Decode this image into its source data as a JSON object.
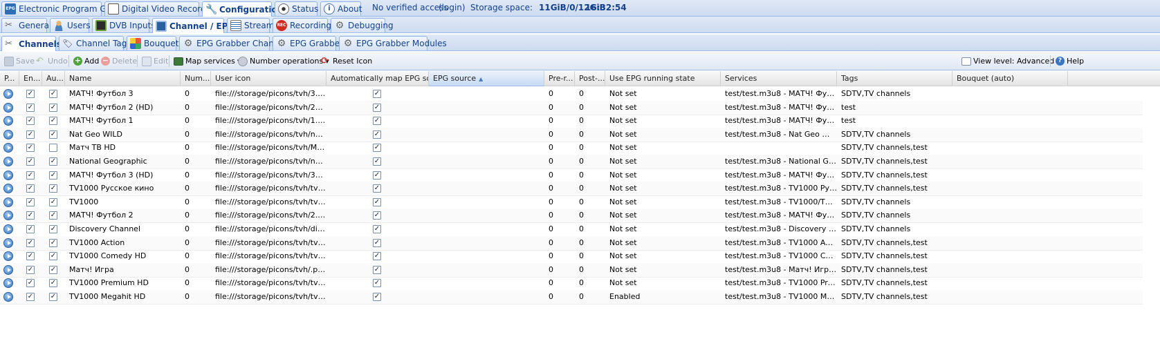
{
  "top_tabs": [
    {
      "label": "Electronic Program Guide",
      "icon": "epg-icon"
    },
    {
      "label": "Digital Video Recorder",
      "icon": "dvr-icon"
    },
    {
      "label": "Configuration",
      "icon": "wrench-icon",
      "active": true
    },
    {
      "label": "Status",
      "icon": "eye-icon"
    },
    {
      "label": "About",
      "icon": "info-icon"
    }
  ],
  "status": {
    "access": "No verified access",
    "login": "(login)",
    "storage_label": "Storage space:",
    "storage_value": "11GiB/0/12GiB",
    "time": "16:32:54"
  },
  "config_tabs": [
    {
      "label": "General"
    },
    {
      "label": "Users"
    },
    {
      "label": "DVB Inputs"
    },
    {
      "label": "Channel / EPG",
      "active": true
    },
    {
      "label": "Stream"
    },
    {
      "label": "Recording"
    },
    {
      "label": "Debugging"
    }
  ],
  "sub_tabs": [
    {
      "label": "Channels",
      "active": true
    },
    {
      "label": "Channel Tags"
    },
    {
      "label": "Bouquets"
    },
    {
      "label": "EPG Grabber Channels"
    },
    {
      "label": "EPG Grabber"
    },
    {
      "label": "EPG Grabber Modules"
    }
  ],
  "toolbar": {
    "save": "Save",
    "undo": "Undo",
    "add": "Add",
    "delete": "Delete",
    "edit": "Edit",
    "map_services": "Map services",
    "number_operations": "Number operations",
    "reset_icon": "Reset Icon",
    "view_level": "View level: Advanced",
    "help": "Help"
  },
  "columns": [
    "P...",
    "En...",
    "Au...",
    "Name",
    "Num...",
    "User icon",
    "Automatically map EPG sou...",
    "EPG source",
    "Pre-r...",
    "Post-...",
    "Use EPG running state",
    "Services",
    "Tags",
    "Bouquet (auto)"
  ],
  "rows": [
    {
      "enabled": true,
      "auto": true,
      "name": "МАТЧ! Футбол 3",
      "number": "0",
      "icon": "file:///storage/picons/tvh/3.png",
      "automap": true,
      "pre": "0",
      "post": "0",
      "running": "Not set",
      "services": "test/test.m3u8 - МАТЧ! Футбол 3...",
      "tags": "SDTV,TV channels"
    },
    {
      "enabled": true,
      "auto": true,
      "name": "МАТЧ! Футбол 2 (HD)",
      "number": "0",
      "icon": "file:///storage/picons/tvh/2hd.png",
      "automap": true,
      "pre": "0",
      "post": "0",
      "running": "Not set",
      "services": "test/test.m3u8 - МАТЧ! Футбол 2...",
      "tags": "test"
    },
    {
      "enabled": true,
      "auto": true,
      "name": "МАТЧ! Футбол 1",
      "number": "0",
      "icon": "file:///storage/picons/tvh/1.png",
      "automap": true,
      "pre": "0",
      "post": "0",
      "running": "Not set",
      "services": "test/test.m3u8 - МАТЧ! Футбол 1...",
      "tags": "test"
    },
    {
      "enabled": true,
      "auto": true,
      "name": "Nat Geo WILD",
      "number": "0",
      "icon": "file:///storage/picons/tvh/natgeow...",
      "automap": true,
      "pre": "0",
      "post": "0",
      "running": "Not set",
      "services": "test/test.m3u8 - Nat Geo WILD/N...",
      "tags": "SDTV,TV channels"
    },
    {
      "enabled": true,
      "auto": false,
      "name": "Матч ТВ HD",
      "number": "0",
      "icon": "file:///storage/picons/tvh/Матч ТВ...",
      "automap": true,
      "pre": "0",
      "post": "0",
      "running": "Not set",
      "services": "",
      "tags": "SDTV,TV channels,test"
    },
    {
      "enabled": true,
      "auto": true,
      "name": "National Geographic",
      "number": "0",
      "icon": "file:///storage/picons/tvh/national...",
      "automap": true,
      "pre": "0",
      "post": "0",
      "running": "Not set",
      "services": "test/test.m3u8 - National Geogra...",
      "tags": "SDTV,TV channels,test"
    },
    {
      "enabled": true,
      "auto": true,
      "name": "МАТЧ! Футбол 3 (HD)",
      "number": "0",
      "icon": "file:///storage/picons/tvh/3hd.png",
      "automap": true,
      "pre": "0",
      "post": "0",
      "running": "Not set",
      "services": "test/test.m3u8 - МАТЧ! Футбол 3...",
      "tags": "SDTV,TV channels,test"
    },
    {
      "enabled": true,
      "auto": true,
      "name": "TV1000 Русское кино",
      "number": "0",
      "icon": "file:///storage/picons/tvh/tv1000.p...",
      "automap": true,
      "pre": "0",
      "post": "0",
      "running": "Not set",
      "services": "test/test.m3u8 - TV1000 Русско...",
      "tags": "SDTV,TV channels,test"
    },
    {
      "enabled": true,
      "auto": true,
      "name": "TV1000",
      "number": "0",
      "icon": "file:///storage/picons/tvh/tv1000.p...",
      "automap": true,
      "pre": "0",
      "post": "0",
      "running": "Not set",
      "services": "test/test.m3u8 - TV1000/TV1000",
      "tags": "SDTV,TV channels"
    },
    {
      "enabled": true,
      "auto": true,
      "name": "МАТЧ! Футбол 2",
      "number": "0",
      "icon": "file:///storage/picons/tvh/2.png",
      "automap": true,
      "pre": "0",
      "post": "0",
      "running": "Not set",
      "services": "test/test.m3u8 - МАТЧ! Футбол 2...",
      "tags": "SDTV,TV channels"
    },
    {
      "enabled": true,
      "auto": true,
      "name": "Discovery Channel",
      "number": "0",
      "icon": "file:///storage/picons/tvh/discove...",
      "automap": true,
      "pre": "0",
      "post": "0",
      "running": "Not set",
      "services": "test/test.m3u8 - Discovery Chan...",
      "tags": "SDTV,TV channels"
    },
    {
      "enabled": true,
      "auto": true,
      "name": "TV1000 Action",
      "number": "0",
      "icon": "file:///storage/picons/tvh/tv1000a...",
      "automap": true,
      "pre": "0",
      "post": "0",
      "running": "Not set",
      "services": "test/test.m3u8 - TV1000 Action/T...",
      "tags": "SDTV,TV channels,test"
    },
    {
      "enabled": true,
      "auto": true,
      "name": "TV1000 Comedy HD",
      "number": "0",
      "icon": "file:///storage/picons/tvh/tv1000c...",
      "automap": true,
      "pre": "0",
      "post": "0",
      "running": "Not set",
      "services": "test/test.m3u8 - TV1000 Comed...",
      "tags": "SDTV,TV channels,test"
    },
    {
      "enabled": true,
      "auto": true,
      "name": "Матч! Игра",
      "number": "0",
      "icon": "file:///storage/picons/tvh/.png",
      "automap": true,
      "pre": "0",
      "post": "0",
      "running": "Not set",
      "services": "test/test.m3u8 - Матч! Игра/Мат...",
      "tags": "SDTV,TV channels,test"
    },
    {
      "enabled": true,
      "auto": true,
      "name": "TV1000 Premium HD",
      "number": "0",
      "icon": "file:///storage/picons/tvh/tv1000p...",
      "automap": true,
      "pre": "0",
      "post": "0",
      "running": "Not set",
      "services": "test/test.m3u8 - TV1000 Premiu...",
      "tags": "SDTV,TV channels,test"
    },
    {
      "enabled": true,
      "auto": true,
      "name": "TV1000 Megahit HD",
      "number": "0",
      "icon": "file:///storage/picons/tvh/tv1000m...",
      "automap": true,
      "pre": "0",
      "post": "0",
      "running": "Enabled",
      "services": "test/test.m3u8 - TV1000 Megahit...",
      "tags": "SDTV,TV channels,test"
    }
  ],
  "colors": {
    "accent": "#15428b",
    "header_blue": "#dfe8f6",
    "border": "#99bbe8"
  }
}
